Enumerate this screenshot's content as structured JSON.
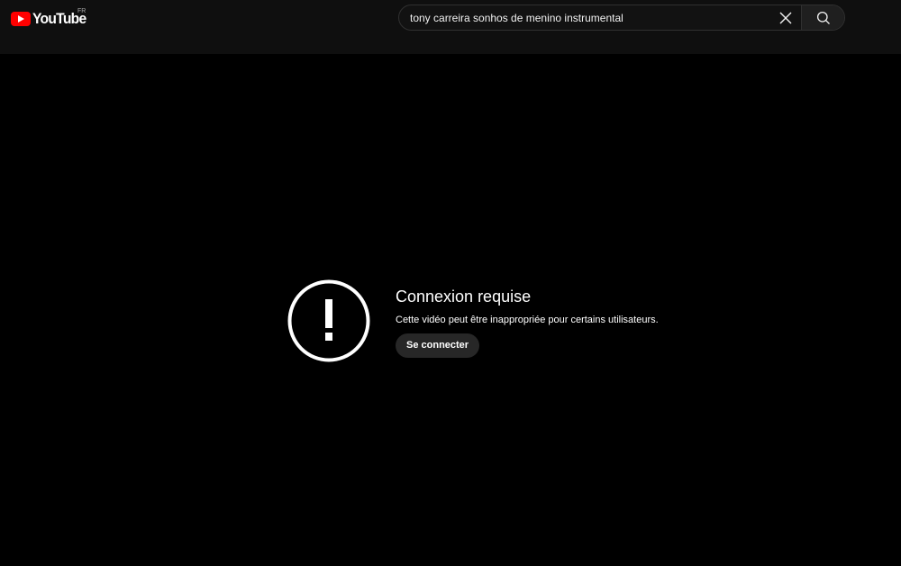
{
  "header": {
    "logo_text": "YouTube",
    "region": "FR",
    "search": {
      "value": "tony carreira sonhos de menino instrumental",
      "clear_icon": "close-icon",
      "search_icon": "search-icon"
    }
  },
  "error": {
    "icon": "alert-circle-icon",
    "title": "Connexion requise",
    "message": "Cette vidéo peut être inappropriée pour certains utilisateurs.",
    "signin_label": "Se connecter"
  },
  "colors": {
    "brand_red": "#ff0000",
    "header_bg": "#0f0f0f",
    "player_bg": "#000000",
    "button_bg": "#272727"
  }
}
